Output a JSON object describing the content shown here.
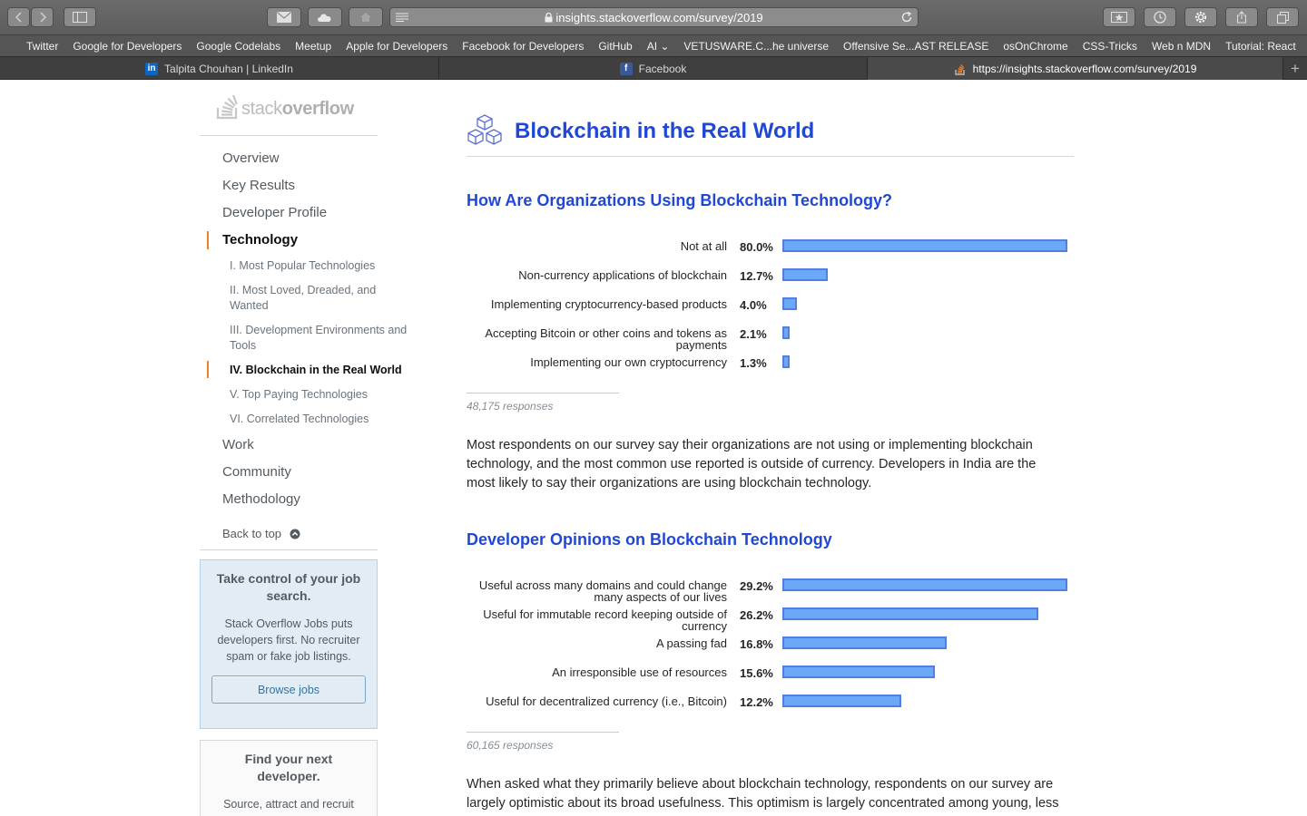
{
  "browser": {
    "url": "insights.stackoverflow.com/survey/2019",
    "bookmarks": [
      "Twitter",
      "Google for Developers",
      "Google Codelabs",
      "Meetup",
      "Apple for Developers",
      "Facebook for Developers",
      "GitHub",
      "AI ⌄",
      "VETUSWARE.C...he universe",
      "Offensive Se...AST RELEASE",
      "osOnChrome",
      "CSS-Tricks",
      "Web n MDN",
      "Tutorial: React"
    ],
    "tabs": [
      {
        "title": "Talpita Chouhan | LinkedIn",
        "icon": "linkedin-icon",
        "active": false
      },
      {
        "title": "Facebook",
        "icon": "facebook-icon",
        "active": false
      },
      {
        "title": "https://insights.stackoverflow.com/survey/2019",
        "icon": "stackoverflow-icon",
        "active": true
      }
    ]
  },
  "logo": {
    "light": "stack",
    "bold": "overflow"
  },
  "nav": {
    "main": [
      "Overview",
      "Key Results",
      "Developer Profile",
      "Technology",
      "Work",
      "Community",
      "Methodology"
    ],
    "active_main": "Technology",
    "sub": [
      "I. Most Popular Technologies",
      "II. Most Loved, Dreaded, and Wanted",
      "III. Development Environments and Tools",
      "IV. Blockchain in the Real World",
      "V. Top Paying Technologies",
      "VI. Correlated Technologies"
    ],
    "active_sub": "IV. Blockchain in the Real World",
    "back_to_top": "Back to top"
  },
  "jobs_card": {
    "title": "Take control of your job search.",
    "body": "Stack Overflow Jobs puts developers first. No recruiter spam or fake job listings.",
    "button": "Browse jobs"
  },
  "dev_card": {
    "title": "Find your next developer.",
    "body": "Source, attract and recruit"
  },
  "section": {
    "title": "Blockchain in the Real World"
  },
  "chart_data": [
    {
      "type": "bar",
      "title": "How Are Organizations Using Blockchain Technology?",
      "categories": [
        "Not at all",
        "Non-currency applications of blockchain",
        "Implementing cryptocurrency-based products",
        "Accepting Bitcoin or other coins and tokens as payments",
        "Implementing our own cryptocurrency"
      ],
      "values": [
        80.0,
        12.7,
        4.0,
        2.1,
        1.3
      ],
      "value_labels": [
        "80.0%",
        "12.7%",
        "4.0%",
        "2.1%",
        "1.3%"
      ],
      "unit": "%",
      "xlim": [
        0,
        80.0
      ],
      "responses": "48,175 responses"
    },
    {
      "type": "bar",
      "title": "Developer Opinions on Blockchain Technology",
      "categories": [
        "Useful across many domains and could change many aspects of our lives",
        "Useful for immutable record keeping outside of currency",
        "A passing fad",
        "An irresponsible use of resources",
        "Useful for decentralized currency (i.e., Bitcoin)"
      ],
      "values": [
        29.2,
        26.2,
        16.8,
        15.6,
        12.2
      ],
      "value_labels": [
        "29.2%",
        "26.2%",
        "16.8%",
        "15.6%",
        "12.2%"
      ],
      "unit": "%",
      "xlim": [
        0,
        29.2
      ],
      "responses": "60,165 responses"
    }
  ],
  "paragraphs": [
    "Most respondents on our survey say their organizations are not using or implementing blockchain technology, and the most common use reported is outside of currency. Developers in India are the most likely to say their organizations are using blockchain technology.",
    "When asked what they primarily believe about blockchain technology, respondents on our survey are largely optimistic about its broad usefulness. This optimism is largely concentrated among young, less"
  ],
  "colors": {
    "accent_blue": "#2148d4",
    "bar_fill": "#6aa9f6",
    "bar_border": "#4f7fe2",
    "nav_active_marker": "#f48024"
  }
}
